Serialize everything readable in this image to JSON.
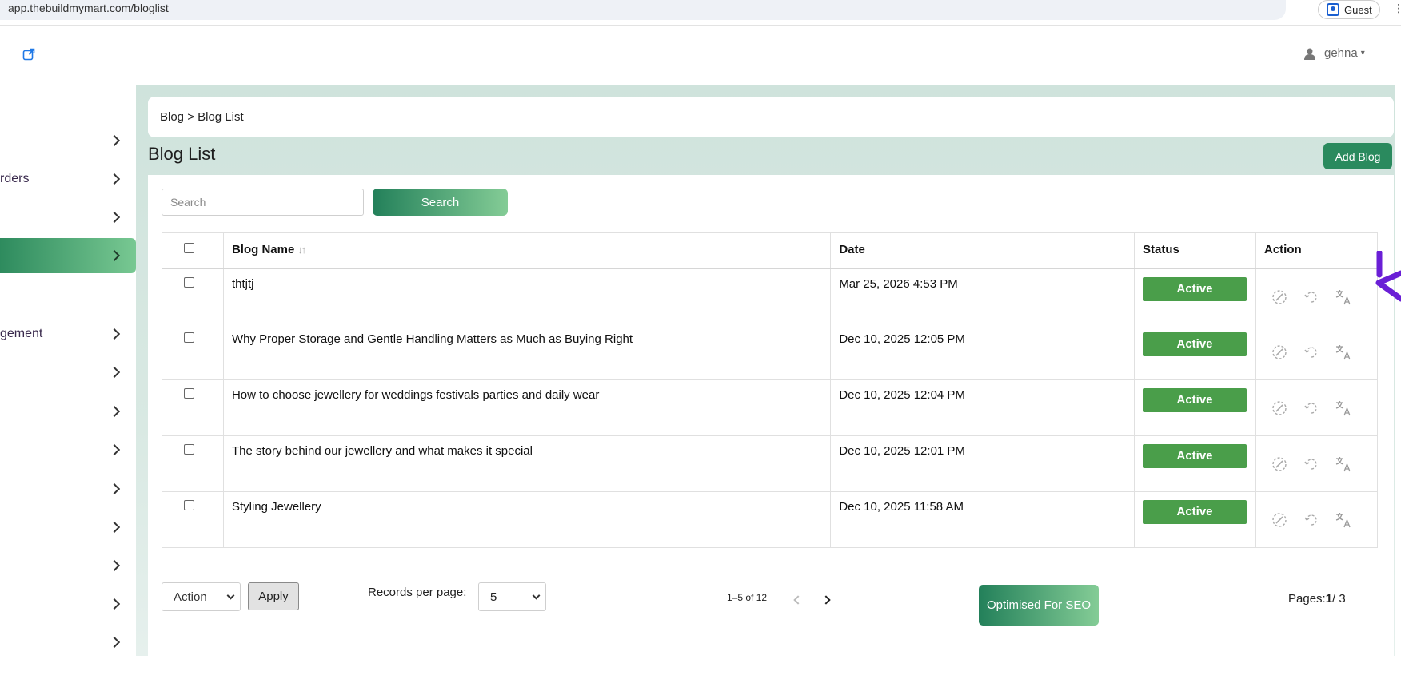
{
  "browser": {
    "url": "app.thebuildmymart.com/bloglist",
    "profile_label": "Guest",
    "menu_glyph": "⋮"
  },
  "header": {
    "user_name": "gehna",
    "user_caret": "▾"
  },
  "sidebar": {
    "items": [
      {
        "label": ""
      },
      {
        "label": "rders"
      },
      {
        "label": ""
      },
      {
        "label": "",
        "active": true
      },
      {
        "label": "gement"
      },
      {
        "label": ""
      },
      {
        "label": ""
      },
      {
        "label": ""
      },
      {
        "label": ""
      },
      {
        "label": ""
      },
      {
        "label": ""
      },
      {
        "label": ""
      },
      {
        "label": ""
      }
    ]
  },
  "breadcrumb": "Blog > Blog List",
  "page": {
    "title": "Blog List",
    "add_button": "Add Blog"
  },
  "search": {
    "placeholder": "Search",
    "button": "Search"
  },
  "table": {
    "columns": [
      "Blog Name",
      "Date",
      "Status",
      "Action"
    ],
    "sort_glyph": "↓↑",
    "rows": [
      {
        "name": "thtjtj",
        "date": "Mar 25, 2026 4:53 PM",
        "status": "Active"
      },
      {
        "name": "Why Proper Storage and Gentle Handling Matters as Much as Buying Right",
        "date": "Dec 10, 2025 12:05 PM",
        "status": "Active"
      },
      {
        "name": "How to choose jewellery for weddings festivals parties and daily wear",
        "date": "Dec 10, 2025 12:04 PM",
        "status": "Active"
      },
      {
        "name": "The story behind our jewellery and what makes it special",
        "date": "Dec 10, 2025 12:01 PM",
        "status": "Active"
      },
      {
        "name": "Styling Jewellery",
        "date": "Dec 10, 2025 11:58 AM",
        "status": "Active"
      }
    ],
    "row_actions": [
      "edit-icon",
      "refresh-icon",
      "translate-icon"
    ]
  },
  "footer": {
    "bulk_action_value": "Action",
    "apply_button": "Apply",
    "records_per_page_label": "Records per page:",
    "records_per_page_value": "5",
    "range": "1–5 of 12",
    "seo_button": "Optimised For SEO",
    "pages_label": "Pages:",
    "current_page": "1",
    "total_pages": "/ 3"
  },
  "colors": {
    "accent_green": "#2a8a5e",
    "status_green": "#4a9e4a",
    "annotation_purple": "#6a1fd6"
  }
}
